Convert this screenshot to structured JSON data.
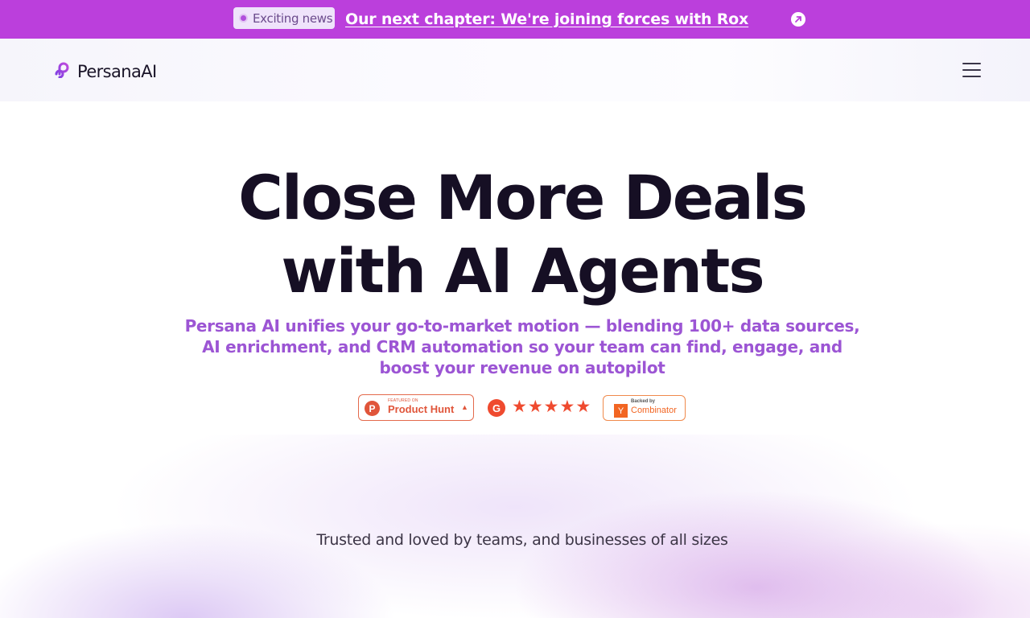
{
  "announcement": {
    "badge_label": "Exciting news",
    "link_text": "Our next chapter: We're joining forces with Rox",
    "arrow_icon": "arrow-up-right-icon",
    "background": "#bb3fdc"
  },
  "header": {
    "logo_text": "PersanaAI",
    "logo_icon": "persana-logo-icon",
    "menu_icon": "hamburger-menu-icon"
  },
  "hero": {
    "title_line1": "Close More Deals",
    "title_line2": "with AI Agents",
    "subtitle": "Persana AI unifies your go-to-market motion — blending 100+ data sources, AI enrichment, and CRM automation so your team can find, engage, and boost your revenue on autopilot",
    "accent_color": "#9c55d4"
  },
  "badges": {
    "product_hunt": {
      "featured_text": "FEATURED ON",
      "name": "Product Hunt",
      "icon": "product-hunt-icon"
    },
    "g2": {
      "icon": "g2-icon",
      "stars": 5,
      "max_stars": 5
    },
    "ycombinator": {
      "backed_text": "Backed by",
      "name": "Combinator",
      "icon": "y-combinator-icon"
    }
  },
  "trusted": {
    "text": "Trusted and loved by teams, and businesses of all sizes"
  }
}
